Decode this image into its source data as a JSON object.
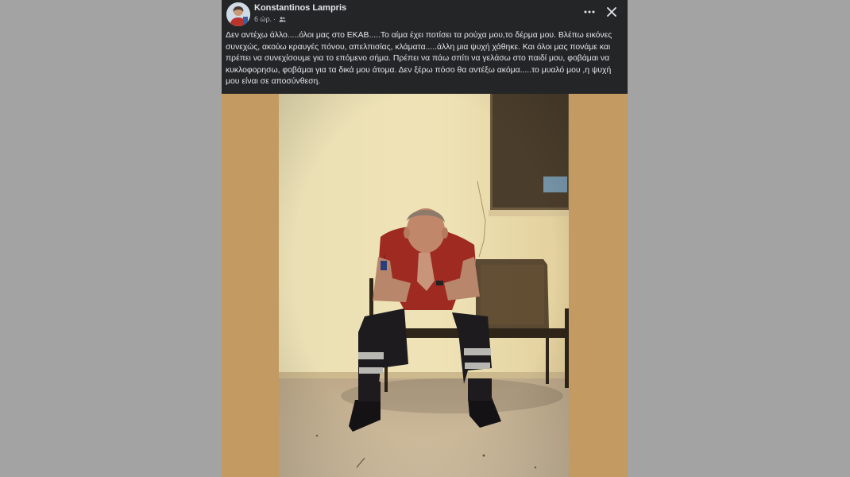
{
  "post": {
    "author": "Konstantinos Lampris",
    "time": "6 ώρ.",
    "separator": "·",
    "audience_icon": "friends-icon",
    "more_icon": "more-options-icon",
    "close_icon": "close-icon",
    "text": "Δεν αντέχω άλλο.....όλοι μας στο ΕΚΑΒ.....Το αίμα έχει ποτίσει τα ρούχα μου,το δέρμα μου. Βλέπω εικόνες συνεχώς, ακούω κραυγές πόνου, απελπισίας, κλάματα.....άλλη μια ψυχή χάθηκε. Και όλοι μας πονάμε και πρέπει να συνεχίσουμε για το επόμενο σήμα.  Πρέπει να πάω σπίτι να γελάσω στο παιδί μου, φοβάμαι να κυκλοφορησω, φοβάμαι για τα δικά μου άτομα. Δεν ξέρω πόσο θα αντέξω ακόμα.....το μυαλό μου ,η ψυχή μου είναι σε αποσύνθεση."
  },
  "colors": {
    "page_background": "#a3a3a3",
    "post_background": "#242526",
    "text_primary": "#e4e6eb",
    "text_secondary": "#b0b3b8",
    "photo_frame": "#c49a63",
    "wall": "#e9dcae"
  }
}
